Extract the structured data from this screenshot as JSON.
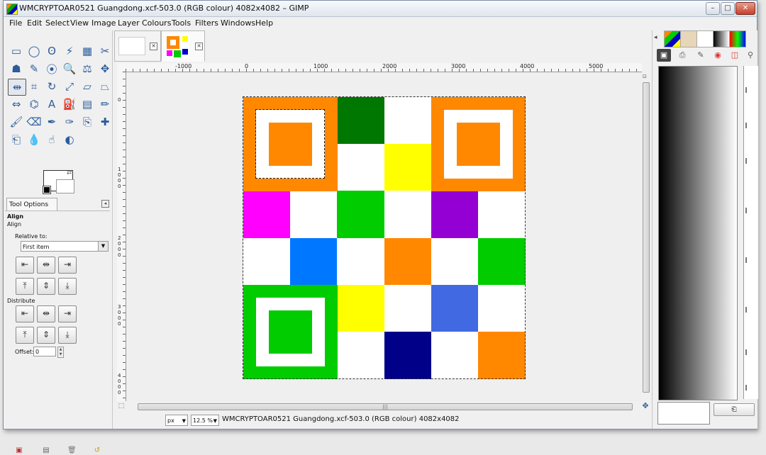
{
  "window": {
    "title": "WMCRYPTOAR0521 Guangdong.xcf-503.0 (RGB colour) 4082x4082 – GIMP",
    "controls": {
      "minimize": "–",
      "maximize": "□",
      "close": "✕"
    }
  },
  "menubar": {
    "items": [
      {
        "label": "File"
      },
      {
        "label": "Edit"
      },
      {
        "label": "Select"
      },
      {
        "label": "View"
      },
      {
        "label": "Image"
      },
      {
        "label": "Layer"
      },
      {
        "label": "Colours"
      },
      {
        "label": "Tools"
      },
      {
        "label": "Filters"
      },
      {
        "label": "Windows"
      },
      {
        "label": "Help"
      }
    ]
  },
  "toolbox": {
    "tools": [
      {
        "name": "rect-select-icon",
        "glyph": "▭"
      },
      {
        "name": "ellipse-select-icon",
        "glyph": "◯"
      },
      {
        "name": "free-select-icon",
        "glyph": "ʘ"
      },
      {
        "name": "fuzzy-select-icon",
        "glyph": "⚡"
      },
      {
        "name": "select-by-color-icon",
        "glyph": "▦"
      },
      {
        "name": "scissors-select-icon",
        "glyph": "✂"
      },
      {
        "name": "foreground-select-icon",
        "glyph": "☗"
      },
      {
        "name": "paths-icon",
        "glyph": "✎"
      },
      {
        "name": "color-picker-icon",
        "glyph": "⦿"
      },
      {
        "name": "zoom-icon",
        "glyph": "🔍"
      },
      {
        "name": "measure-icon",
        "glyph": "⚖"
      },
      {
        "name": "move-icon",
        "glyph": "✥"
      },
      {
        "name": "align-icon",
        "glyph": "⇹"
      },
      {
        "name": "crop-icon",
        "glyph": "⌗"
      },
      {
        "name": "rotate-icon",
        "glyph": "↻"
      },
      {
        "name": "scale-icon",
        "glyph": "⤢"
      },
      {
        "name": "shear-icon",
        "glyph": "▱"
      },
      {
        "name": "perspective-icon",
        "glyph": "⏢"
      },
      {
        "name": "flip-icon",
        "glyph": "⇔"
      },
      {
        "name": "cage-transform-icon",
        "glyph": "⌬"
      },
      {
        "name": "text-icon",
        "glyph": "A"
      },
      {
        "name": "bucket-fill-icon",
        "glyph": "⛽"
      },
      {
        "name": "blend-icon",
        "glyph": "▤"
      },
      {
        "name": "pencil-icon",
        "glyph": "✏"
      },
      {
        "name": "paintbrush-icon",
        "glyph": "🖌"
      },
      {
        "name": "eraser-icon",
        "glyph": "⌫"
      },
      {
        "name": "airbrush-icon",
        "glyph": "✒"
      },
      {
        "name": "ink-icon",
        "glyph": "✑"
      },
      {
        "name": "clone-icon",
        "glyph": "⎘"
      },
      {
        "name": "heal-icon",
        "glyph": "✚"
      },
      {
        "name": "perspective-clone-icon",
        "glyph": "⎗"
      },
      {
        "name": "blur-icon",
        "glyph": "💧"
      },
      {
        "name": "smudge-icon",
        "glyph": "☝"
      },
      {
        "name": "dodge-burn-icon",
        "glyph": "◐"
      }
    ]
  },
  "tool_options": {
    "tab_label": "Tool Options",
    "heading": "Align",
    "subheading": "Align",
    "relative_to_label": "Relative to:",
    "relative_to_value": "First item",
    "distribute_label": "Distribute",
    "offset_label": "Offset:",
    "offset_value": "0",
    "align_buttons": [
      "⇤",
      "⇹",
      "⇥",
      "⤒",
      "⇕",
      "⤓"
    ],
    "distribute_buttons": [
      "⇤",
      "⇹",
      "⇥",
      "⤒",
      "⇕",
      "⤓"
    ]
  },
  "rulers": {
    "h_labels": [
      "-1000",
      "0",
      "1000",
      "2000",
      "3000",
      "4000",
      "5000"
    ],
    "v_labels": [
      "0",
      "1000",
      "2000",
      "3000",
      "4000"
    ]
  },
  "statusbar": {
    "unit": "px",
    "zoom": "12.5 %",
    "text": "WMCRYPTOAR0521 Guangdong.xcf-503.0 (RGB colour) 4082x4082"
  },
  "dock": {
    "edit_button": "⎗"
  },
  "colors": {
    "orange": "#ff8800",
    "dark_green": "#007700",
    "yellow": "#ffff00",
    "magenta": "#ff00ff",
    "green": "#00cc00",
    "purple": "#9400d3",
    "blue": "#0077ff",
    "royal_blue": "#4169e1",
    "navy": "#000088",
    "white": "#ffffff"
  }
}
